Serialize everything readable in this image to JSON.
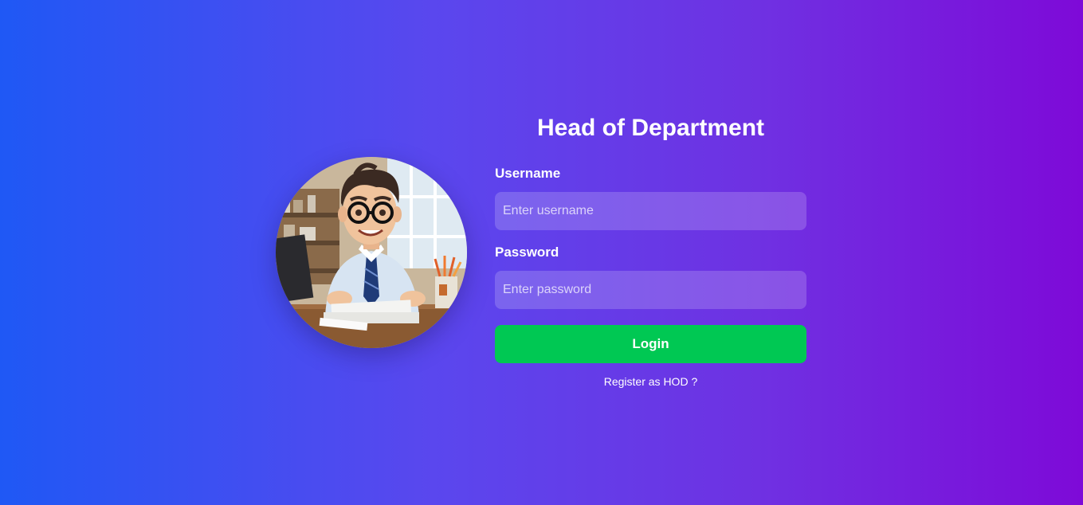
{
  "page": {
    "title": "Head of Department"
  },
  "avatar": {
    "icon": "office-worker-illustration"
  },
  "form": {
    "username_label": "Username",
    "username_placeholder": "Enter username",
    "username_value": "",
    "password_label": "Password",
    "password_placeholder": "Enter password",
    "password_value": "",
    "login_label": "Login",
    "register_link": "Register as HOD ?"
  },
  "colors": {
    "gradient_start": "#1f58f5",
    "gradient_end": "#7e0ad8",
    "login_button": "#00c853",
    "text": "#ffffff"
  }
}
